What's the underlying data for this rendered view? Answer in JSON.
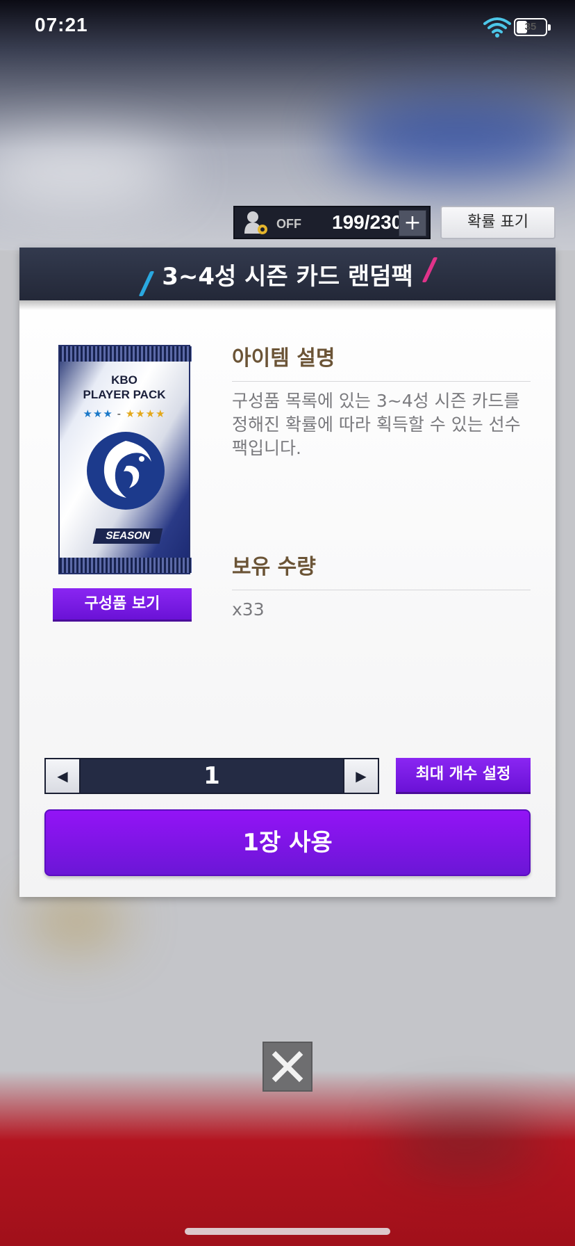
{
  "status_bar": {
    "time": "07:21",
    "battery_level": "35"
  },
  "top_bar": {
    "auto_label": "OFF",
    "inventory_count": "199/230",
    "add_symbol": "+",
    "probability_label": "확률 표기"
  },
  "modal": {
    "title": "3~4성 시즌 카드 랜덤팩",
    "pack": {
      "line1": "KBO",
      "line2": "PLAYER PACK",
      "tag": "SEASON"
    },
    "view_contents_label": "구성품 보기",
    "description_title": "아이템 설명",
    "description_text": "구성품 목록에 있는 3~4성 시즌 카드를 정해진 확률에 따라 획득할 수 있는 선수팩입니다.",
    "owned_title": "보유 수량",
    "owned_value": "x33",
    "quantity": "1",
    "max_label": "최대 개수 설정",
    "use_label": "1장 사용"
  },
  "colors": {
    "accent_purple": "#7a1ae8",
    "header_navy": "#2b3144",
    "title_brown": "#6b5436"
  },
  "icons": [
    "wifi-icon",
    "battery-icon",
    "auto-play-icon",
    "plus-icon",
    "arrow-left-icon",
    "arrow-right-icon",
    "close-icon"
  ]
}
